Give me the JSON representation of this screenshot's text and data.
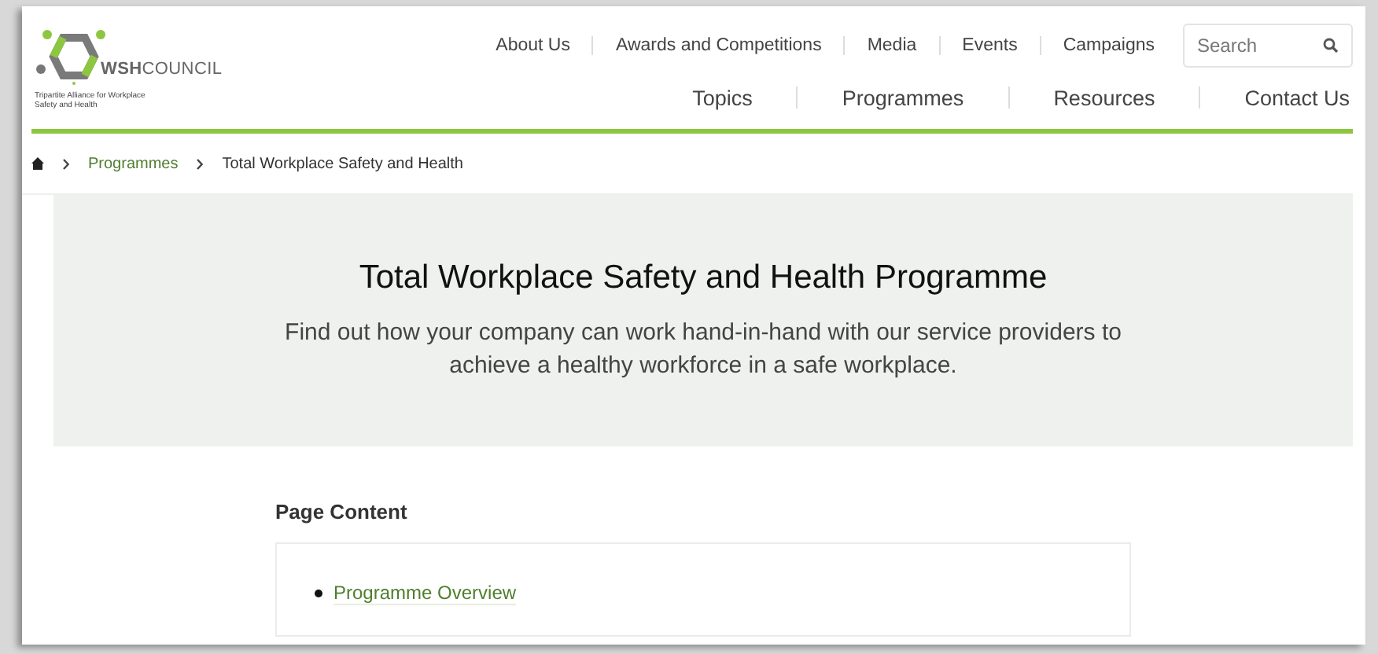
{
  "logo": {
    "name": "**WSH**COUNCIL",
    "tagline": "Tripartite Alliance for Workplace Safety and Health"
  },
  "top_nav": [
    "About Us",
    "Awards and Competitions",
    "Media",
    "Events",
    "Campaigns"
  ],
  "search": {
    "placeholder": "Search"
  },
  "main_nav": [
    "Topics",
    "Programmes",
    "Resources",
    "Contact Us"
  ],
  "breadcrumb": [
    {
      "label": "Programmes",
      "kind": "link"
    },
    {
      "label": "Total Workplace Safety and Health",
      "kind": "current"
    }
  ],
  "hero": {
    "title": "Total Workplace Safety and Health Programme",
    "subtitle": "Find out how your company can work hand-in-hand with our service providers to achieve a healthy workforce in a safe workplace."
  },
  "page_content": {
    "heading": "Page Content",
    "items": [
      "Programme Overview"
    ]
  }
}
